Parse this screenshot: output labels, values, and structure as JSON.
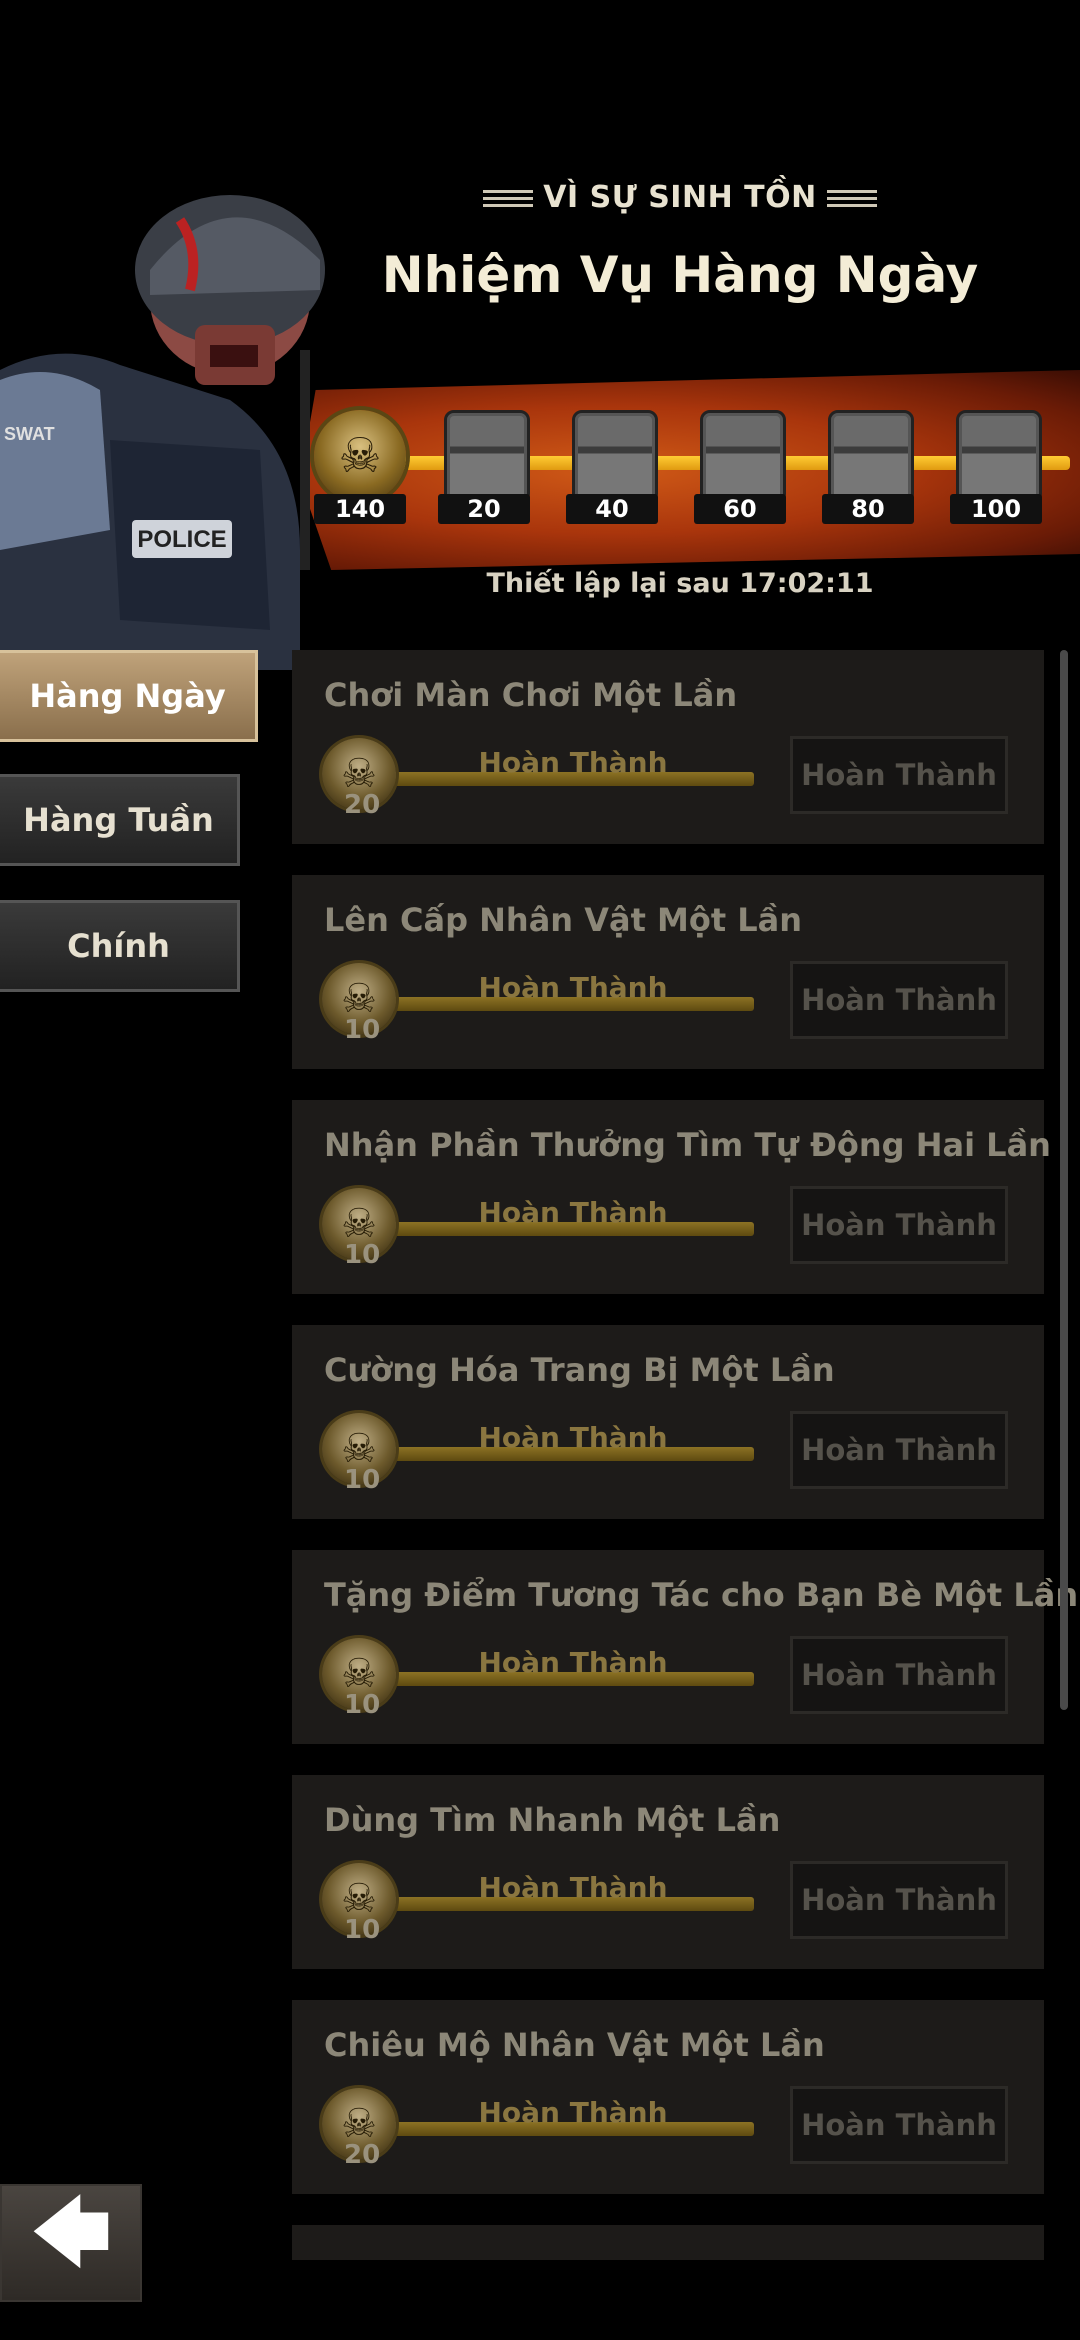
{
  "header": {
    "subtitle": "VÌ SỰ SINH TỒN",
    "title": "Nhiệm Vụ Hàng Ngày",
    "reset_label": "Thiết lập lại sau 17:02:11"
  },
  "progress": {
    "current_points": "140",
    "milestones": [
      "20",
      "40",
      "60",
      "80",
      "100"
    ]
  },
  "tabs": [
    {
      "label": "Hàng Ngày",
      "active": true
    },
    {
      "label": "Hàng Tuần",
      "active": false
    },
    {
      "label": "Chính",
      "active": false
    }
  ],
  "quests": [
    {
      "title": "Chơi Màn Chơi Một Lần",
      "reward": "20",
      "progress_label": "Hoàn Thành",
      "button": "Hoàn Thành"
    },
    {
      "title": "Lên Cấp Nhân Vật Một Lần",
      "reward": "10",
      "progress_label": "Hoàn Thành",
      "button": "Hoàn Thành"
    },
    {
      "title": "Nhận Phần Thưởng Tìm Tự Động Hai Lần",
      "reward": "10",
      "progress_label": "Hoàn Thành",
      "button": "Hoàn Thành"
    },
    {
      "title": "Cường Hóa Trang Bị Một Lần",
      "reward": "10",
      "progress_label": "Hoàn Thành",
      "button": "Hoàn Thành"
    },
    {
      "title": "Tặng Điểm Tương Tác cho Bạn Bè Một Lần",
      "reward": "10",
      "progress_label": "Hoàn Thành",
      "button": "Hoàn Thành"
    },
    {
      "title": "Dùng Tìm Nhanh Một Lần",
      "reward": "10",
      "progress_label": "Hoàn Thành",
      "button": "Hoàn Thành"
    },
    {
      "title": "Chiêu Mộ Nhân Vật Một Lần",
      "reward": "20",
      "progress_label": "Hoàn Thành",
      "button": "Hoàn Thành"
    }
  ],
  "hero": {
    "badge_text": "POLICE",
    "shoulder_text": "SWAT"
  },
  "icons": {
    "back": "back-arrow-icon",
    "skull": "skull-icon",
    "chest": "chest-icon"
  }
}
